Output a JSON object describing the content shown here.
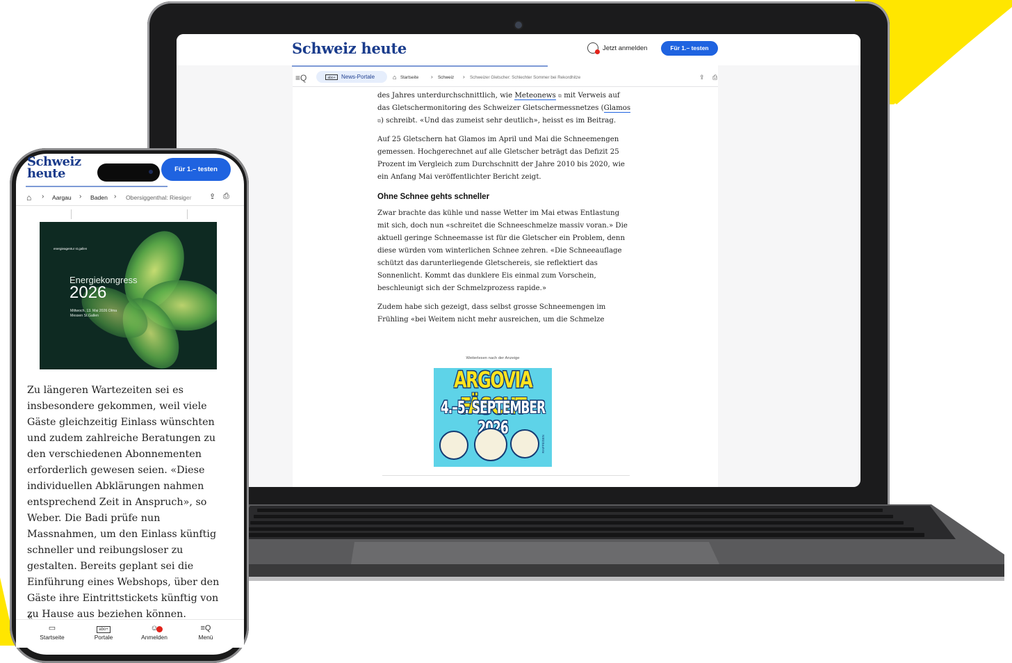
{
  "laptop": {
    "logo": "Schweiz heute",
    "login_label": "Jetzt anmelden",
    "trial_button": "Für 1.– testen",
    "portale_abo": "abo+",
    "portale_label": "News-Portale",
    "breadcrumb": [
      "Startseite",
      "Schweiz",
      "Schweizer Gletscher: Schlechter Sommer bei Rekordhitze"
    ],
    "article": {
      "p1_a": "des Jahres unterdurchschnittlich, wie ",
      "p1_link1": "Meteonews",
      "p1_b": " mit Verweis auf das Gletschermonitoring des Schweizer Gletschermessnetzes (",
      "p1_link2": "Glamos",
      "p1_c": ") schreibt. «Und das zumeist sehr deutlich», heisst es im Beitrag.",
      "p2": "Auf 25 Gletschern hat Glamos im April und Mai die Schneemengen gemessen. Hochgerechnet auf alle Gletscher beträgt das Defizit 25 Prozent im Vergleich zum Durchschnitt der Jahre 2010 bis 2020, wie ein Anfang Mai veröffentlichter Bericht zeigt.",
      "heading": "Ohne Schnee gehts schneller",
      "p3": "Zwar brachte das kühle und nasse Wetter im Mai etwas Entlastung mit sich, doch nun «schreitet die Schneeschmelze massiv voran.» Die aktuell geringe Schneemasse ist für die Gletscher ein Problem, denn diese würden vom winterlichen Schnee zehren. «Die Schneeauflage schützt das darunterliegende Gletschereis, sie reflektiert das Sonnenlicht. Kommt das dunklere Eis einmal zum Vorschein, beschleunigt sich der Schmelzprozess rapide.»",
      "p4": "Zudem habe sich gezeigt, dass selbst grosse Schneemengen im Frühling «bei Weitem nicht mehr ausreichen, um die Schmelze"
    },
    "ad_label": "Weiterlesen nach der Anzeige",
    "ad": {
      "line1": "ARGOVIA FÄSCHT",
      "line2": "4.–5. SEPTEMBER 2026",
      "sponsor": "RAIFFEISEN"
    }
  },
  "phone": {
    "logo": "Schweiz heute",
    "trial_button": "Für 1.– testen",
    "breadcrumb": [
      "Aargau",
      "Baden",
      "Obersiggenthal: Riesiger"
    ],
    "image": {
      "org": "energieagentur st.gallen",
      "title": "Energiekongress",
      "year": "2026",
      "date": "Mittwoch, 13. Mai 2026 Olma Messen St.Gallen"
    },
    "article_text": "Zu längeren Wartezeiten sei es insbesondere gekommen, weil viele Gäste gleichzeitig Einlass wünschten und zudem zahlreiche Beratungen zu den verschiedenen Abonnementen erforderlich gewesen seien. «Diese individuellen Abklärungen nahmen entsprechend Zeit in Anspruch», so Weber. Die Badi prüfe nun Massnahmen, um den Einlass künftig schneller und reibungsloser zu gestalten. Bereits geplant sei die Einführung eines Webshops, über den Gäste ihre Eintrittstickets künftig von zu Hause aus beziehen können.",
    "next_line": "«",
    "tabs": [
      {
        "label": "Startseite",
        "icon": "home-icon"
      },
      {
        "label": "Portale",
        "icon": "abo-icon",
        "abo": "abo+"
      },
      {
        "label": "Anmelden",
        "icon": "user-icon"
      },
      {
        "label": "Menü",
        "icon": "menu-search-icon"
      }
    ]
  },
  "colors": {
    "brand_blue": "#1a3c8c",
    "button_blue": "#1f63e0",
    "accent_yellow": "#ffe600",
    "alert_red": "#e2231a"
  }
}
